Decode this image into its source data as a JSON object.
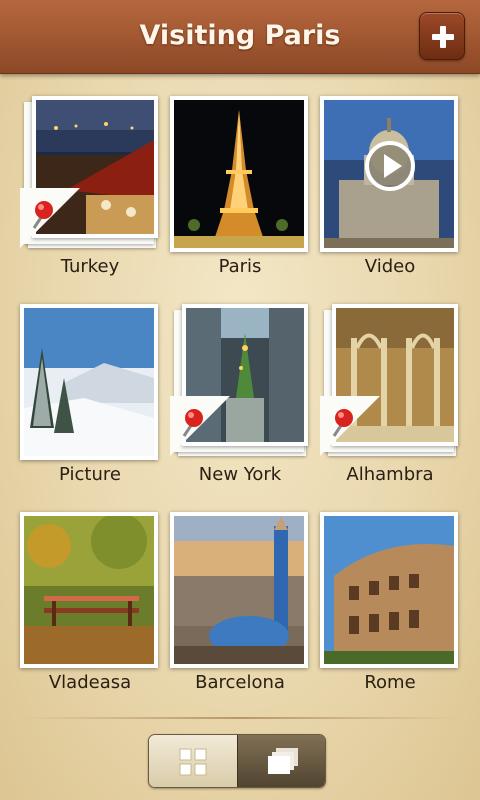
{
  "header": {
    "title": "Visiting Paris",
    "add_icon": "plus-icon"
  },
  "grid": [
    {
      "label": "Turkey",
      "kind": "place",
      "pinned": true
    },
    {
      "label": "Paris",
      "kind": "photo",
      "pinned": false
    },
    {
      "label": "Video",
      "kind": "video",
      "pinned": false
    },
    {
      "label": "Picture",
      "kind": "photo",
      "pinned": false
    },
    {
      "label": "New York",
      "kind": "place",
      "pinned": true
    },
    {
      "label": "Alhambra",
      "kind": "place",
      "pinned": true
    },
    {
      "label": "Vladeasa",
      "kind": "photo",
      "pinned": false
    },
    {
      "label": "Barcelona",
      "kind": "photo",
      "pinned": false
    },
    {
      "label": "Rome",
      "kind": "photo",
      "pinned": false
    }
  ],
  "view_toggle": {
    "grid_icon": "grid-view-icon",
    "stack_icon": "stack-view-icon",
    "selected": "grid"
  },
  "colors": {
    "header": "#a45a33",
    "label": "#2a2013",
    "pin": "#d9231f"
  }
}
